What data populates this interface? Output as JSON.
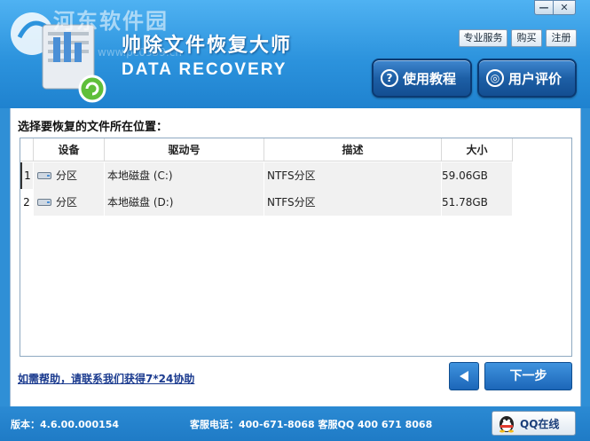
{
  "header": {
    "watermark": "河东软件园",
    "watermark_url": "www.pc0359.cn",
    "title": "帅除文件恢复大师",
    "subtitle": "DATA RECOVERY",
    "window_controls": {
      "minimize": "—",
      "close": "✕"
    },
    "top_buttons": {
      "service": "专业服务",
      "buy": "购买",
      "register": "注册"
    },
    "big_buttons": {
      "tutorial": "使用教程",
      "review": "用户评价"
    }
  },
  "main": {
    "prompt": "选择要恢复的文件所在位置：",
    "columns": [
      "",
      "设备",
      "驱动号",
      "描述",
      "大小"
    ],
    "rows": [
      {
        "index": "1",
        "device": "分区",
        "drive": "本地磁盘 (C:)",
        "desc": "NTFS分区",
        "size": "59.06GB"
      },
      {
        "index": "2",
        "device": "分区",
        "drive": "本地磁盘 (D:)",
        "desc": "NTFS分区",
        "size": "51.78GB"
      }
    ],
    "help_link": "如需帮助，请联系我们获得7*24协助",
    "next_label": "下一步"
  },
  "footer": {
    "version": "版本：4.6.00.000154",
    "contact": "客服电话：400-671-8068 客服QQ 400 671 8068",
    "qq_label": "QQ在线"
  },
  "colors": {
    "header_bg": "#2c93dd",
    "button_blue": "#1c66b8",
    "link": "#1b3b8f"
  }
}
